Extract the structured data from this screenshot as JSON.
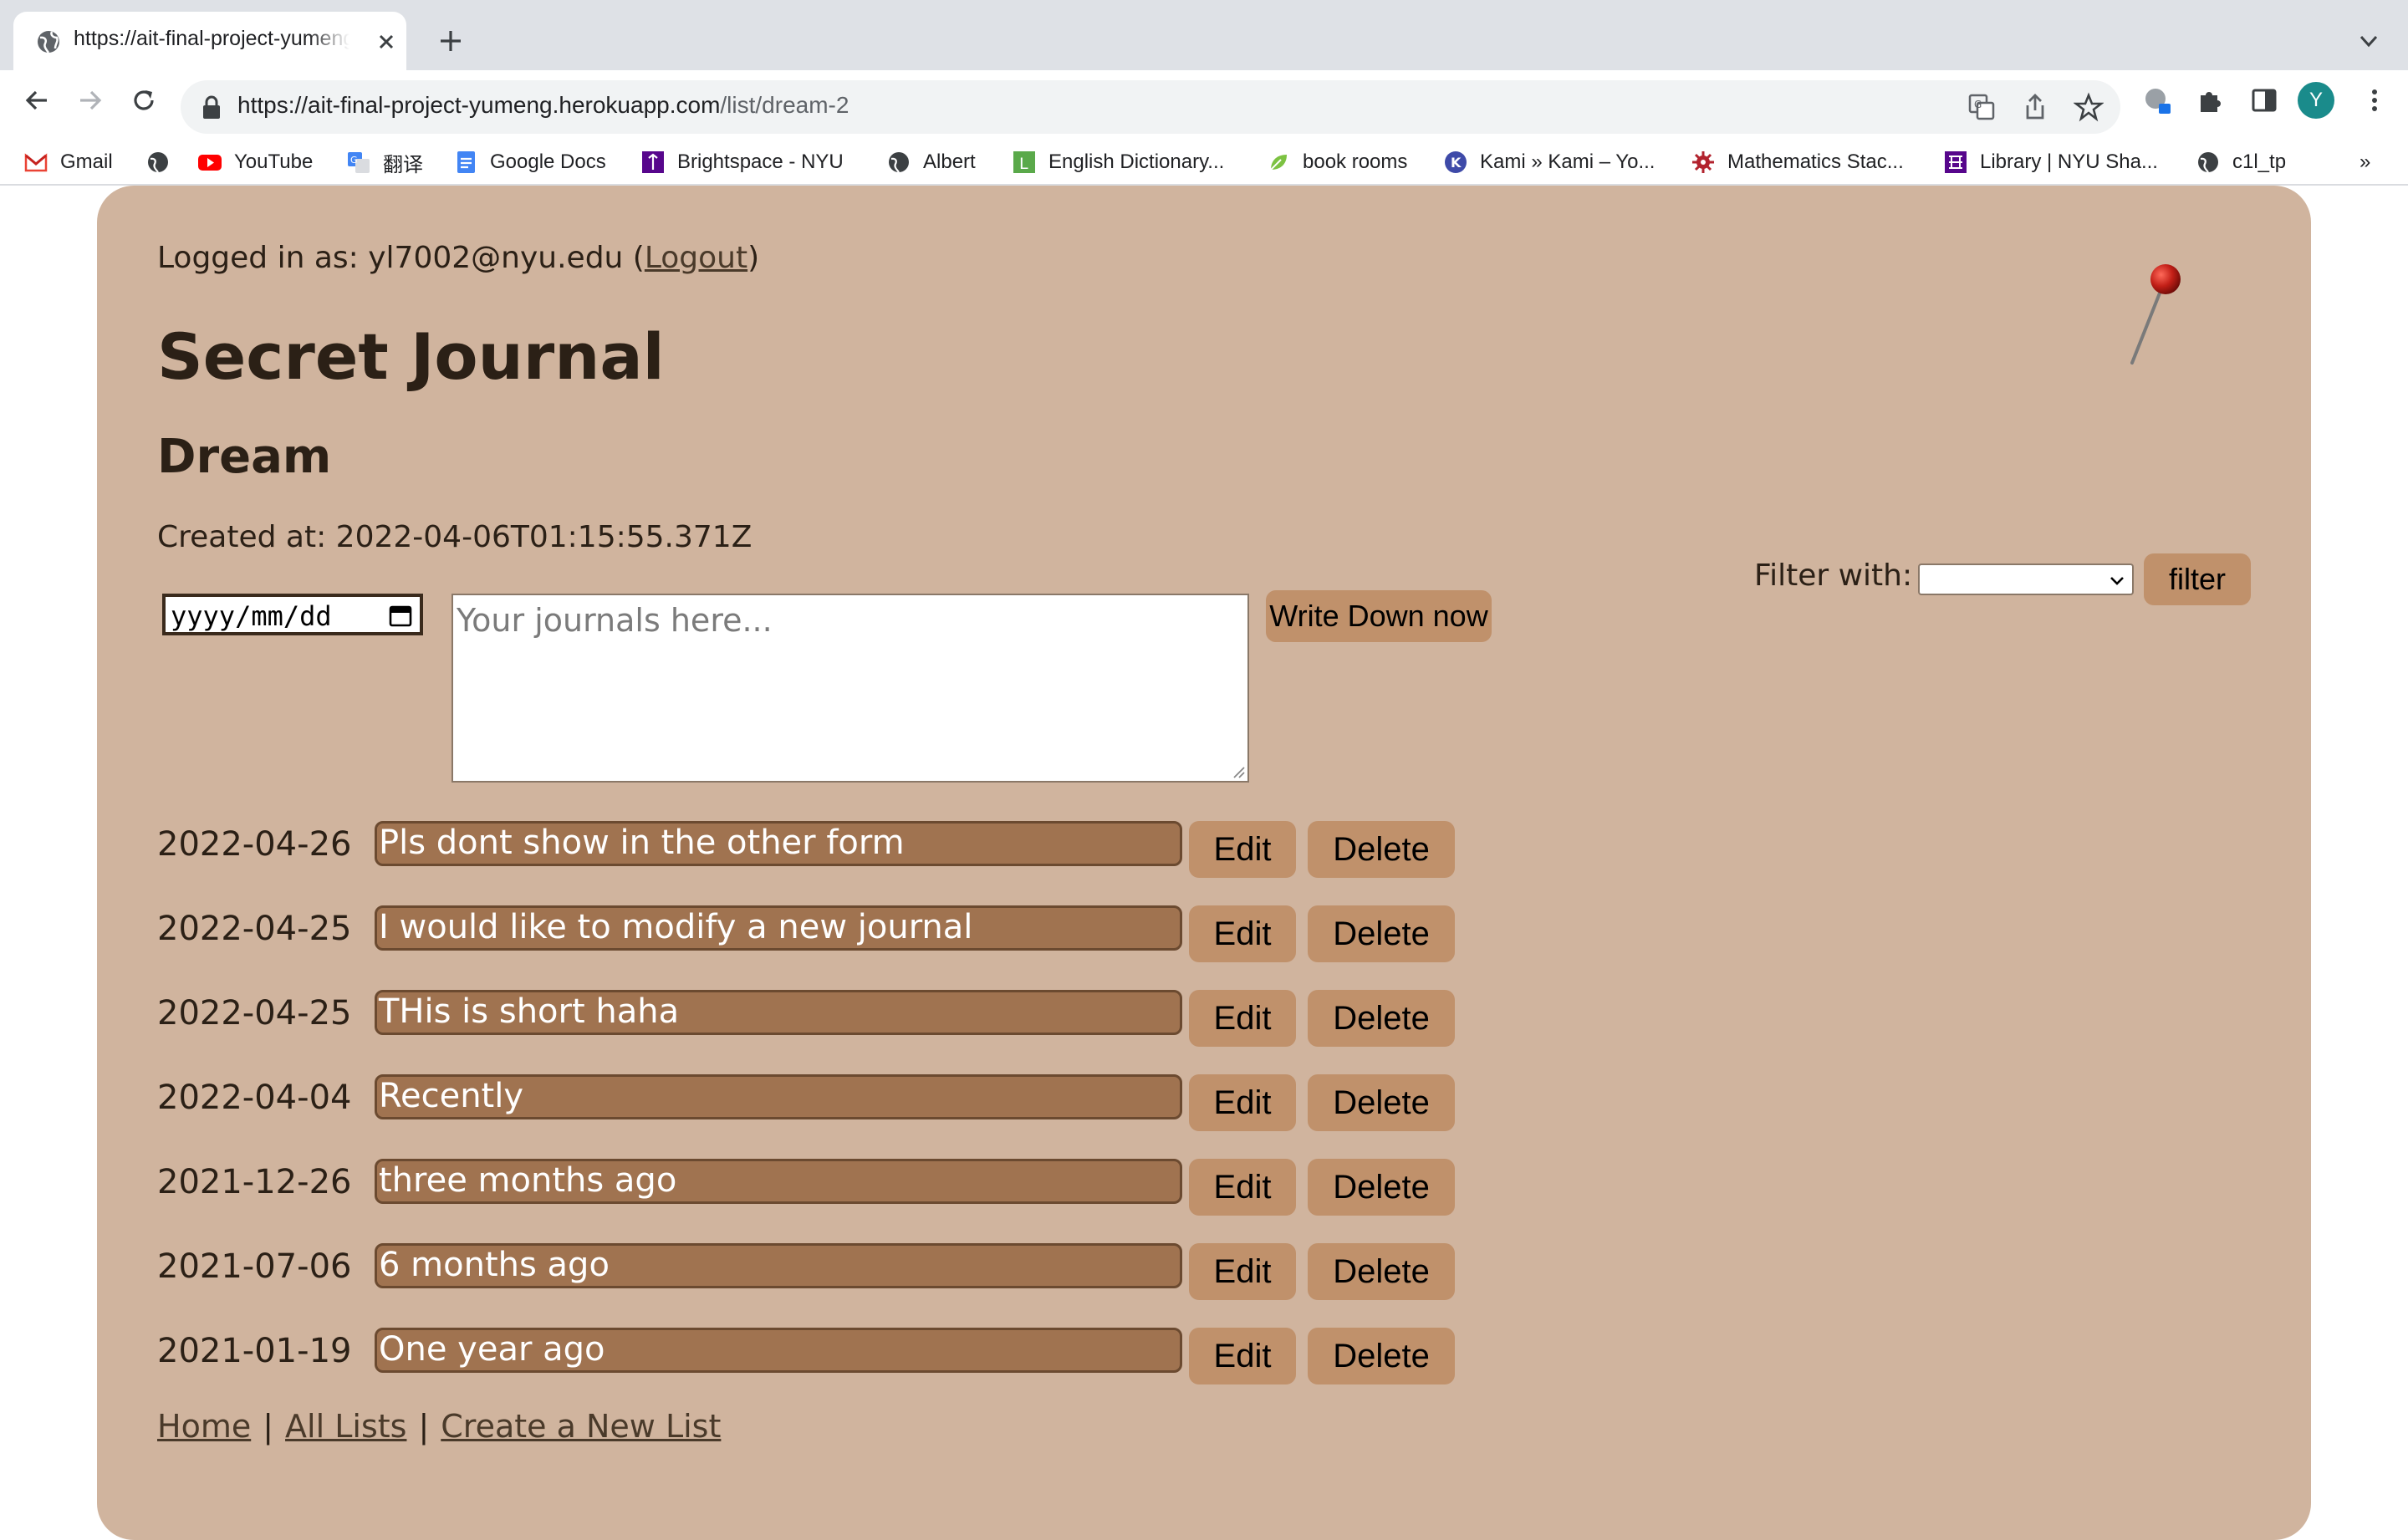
{
  "browser": {
    "tab_title": "https://ait-final-project-yumeng.herokuapp.com/list/dream-2",
    "url_host": "https://ait-final-project-yumeng.herokuapp.com",
    "url_path": "/list/dream-2",
    "profile_initial": "Y",
    "bookmarks": [
      {
        "label": "Gmail",
        "icon": "gmail-icon"
      },
      {
        "label": "",
        "icon": "globe-icon"
      },
      {
        "label": "YouTube",
        "icon": "youtube-icon"
      },
      {
        "label": "翻译",
        "icon": "translate-icon"
      },
      {
        "label": "Google Docs",
        "icon": "docs-icon"
      },
      {
        "label": "Brightspace - NYU",
        "icon": "nyu-icon"
      },
      {
        "label": "Albert",
        "icon": "globe-icon"
      },
      {
        "label": "English Dictionary...",
        "icon": "dictionary-icon"
      },
      {
        "label": "book rooms",
        "icon": "leaf-icon"
      },
      {
        "label": "Kami » Kami – Yo...",
        "icon": "kami-icon"
      },
      {
        "label": "Mathematics Stac...",
        "icon": "stackexchange-icon"
      },
      {
        "label": "Library | NYU Sha...",
        "icon": "library-icon"
      },
      {
        "label": "c1l_tp",
        "icon": "globe-icon"
      }
    ],
    "more_bookmarks": "»"
  },
  "page": {
    "login_prefix": "Logged in as: yl7002@nyu.edu (",
    "logout_label": "Logout",
    "login_suffix": ")",
    "site_title": "Secret Journal",
    "list_title": "Dream",
    "created_at": "Created at: 2022-04-06T01:15:55.371Z",
    "date_placeholder": "yyyy/mm/dd",
    "journal_placeholder": "Your journals here...",
    "write_button": "Write Down now",
    "filter_label": "Filter with:",
    "filter_selected": "",
    "filter_button": "filter",
    "entries": [
      {
        "date": "2022-04-26",
        "text": "Pls dont show in the other form",
        "edit": "Edit",
        "delete": "Delete"
      },
      {
        "date": "2022-04-25",
        "text": "I would like to modify a new journal",
        "edit": "Edit",
        "delete": "Delete"
      },
      {
        "date": "2022-04-25",
        "text": "THis is short haha",
        "edit": "Edit",
        "delete": "Delete"
      },
      {
        "date": "2022-04-04",
        "text": "Recently",
        "edit": "Edit",
        "delete": "Delete"
      },
      {
        "date": "2021-12-26",
        "text": "three months ago",
        "edit": "Edit",
        "delete": "Delete"
      },
      {
        "date": "2021-07-06",
        "text": "6 months ago",
        "edit": "Edit",
        "delete": "Delete"
      },
      {
        "date": "2021-01-19",
        "text": "One year ago",
        "edit": "Edit",
        "delete": "Delete"
      }
    ],
    "footer": {
      "home": "Home",
      "all_lists": "All Lists",
      "create_list": "Create a New List",
      "separator": "|"
    }
  },
  "colors": {
    "panel": "#d0b49e",
    "button": "#c0916b",
    "entry_field": "#a07350",
    "text": "#2b2016"
  }
}
